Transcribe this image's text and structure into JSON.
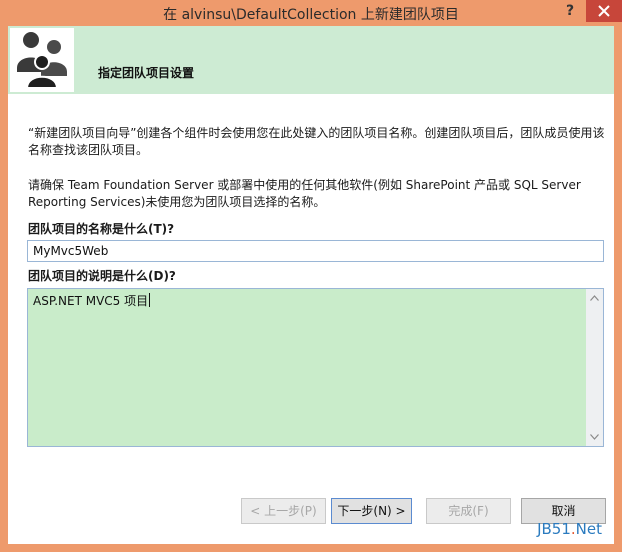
{
  "window": {
    "title": "在 alvinsu\\DefaultCollection 上新建团队项目",
    "help_glyph": "?"
  },
  "header": {
    "title": "指定团队项目设置",
    "icon": "team-people-icon"
  },
  "description": {
    "line1": "“新建团队项目向导”创建各个组件时会使用您在此处键入的团队项目名称。创建团队项目后，团队成员使用该名称查找该团队项目。",
    "line2": "请确保 Team Foundation Server 或部署中使用的任何其他软件(例如 SharePoint 产品或 SQL Server Reporting Services)未使用您为团队项目选择的名称。"
  },
  "form": {
    "name_label": "团队项目的名称是什么(T)?",
    "name_value": "MyMvc5Web",
    "desc_label": "团队项目的说明是什么(D)?",
    "desc_value": "ASP.NET MVC5 项目"
  },
  "buttons": {
    "back": "< 上一步(P)",
    "next": "下一步(N) >",
    "finish": "完成(F)",
    "cancel": "取消"
  },
  "watermark": {
    "part1": "JB51",
    "dot": ".",
    "part2": "Net"
  },
  "colors": {
    "title_bar": "#ee9a6c",
    "header_bg": "#cdebd3",
    "description_bg": "#c9ecca",
    "close_button": "#c7463a"
  }
}
